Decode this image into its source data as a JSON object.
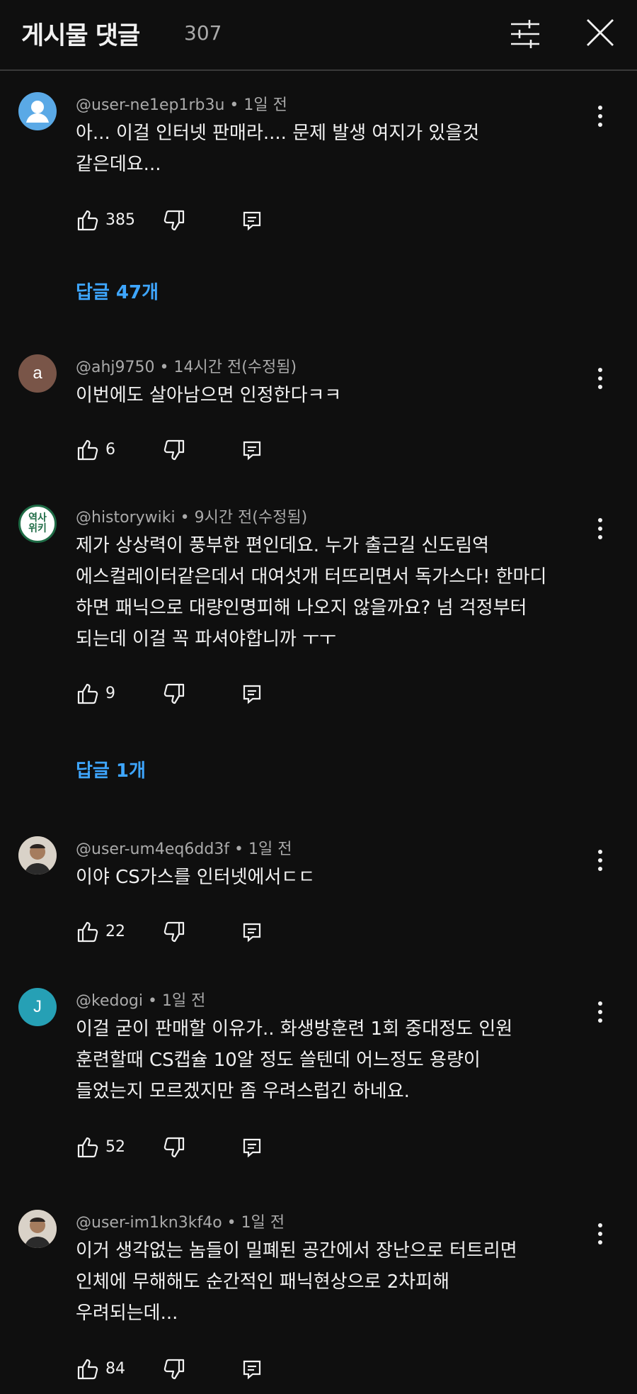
{
  "header": {
    "title": "게시물 댓글",
    "count": "307",
    "icons": [
      "filter-icon",
      "close-icon"
    ]
  },
  "comments": [
    {
      "author": "@user-ne1ep1rb3u",
      "time": "1일 전",
      "meta": "@user-ne1ep1rb3u • 1일 전",
      "avatar": {
        "type": "default-person",
        "color": "#5aa9e6"
      },
      "lines": [
        "아... 이걸 인터넷 판매라.... 문제 발생 여지가 있을것",
        "같은데요..."
      ],
      "likes": "385",
      "replies_label": "답글 47개"
    },
    {
      "author": "@ahj9750",
      "time": "14시간 전(수정됨)",
      "meta": "@ahj9750 • 14시간 전(수정됨)",
      "avatar": {
        "type": "letter",
        "letter": "a",
        "color": "#795548"
      },
      "lines": [
        "이번에도 살아남으면 인정한다ㅋㅋ"
      ],
      "likes": "6",
      "replies_label": ""
    },
    {
      "author": "@historywiki",
      "time": "9시간 전(수정됨)",
      "meta": "@historywiki • 9시간 전(수정됨)",
      "avatar": {
        "type": "logo",
        "text_top": "역사",
        "text_bottom": "위키",
        "color": "#1e6b45"
      },
      "lines": [
        "제가 상상력이 풍부한 편인데요. 누가 출근길 신도림역",
        "에스컬레이터같은데서 대여섯개 터뜨리면서 독가스다! 한마디",
        "하면 패닉으로 대량인명피해 나오지 않을까요? 넘 걱정부터",
        "되는데 이걸 꼭 파셔야합니까 ㅜㅜ"
      ],
      "likes": "9",
      "replies_label": "답글 1개"
    },
    {
      "author": "@user-um4eq6dd3f",
      "time": "1일 전",
      "meta": "@user-um4eq6dd3f • 1일 전",
      "avatar": {
        "type": "photo",
        "color": "#6b5a4e"
      },
      "lines": [
        "이야 CS가스를 인터넷에서ㄷㄷ"
      ],
      "likes": "22",
      "replies_label": ""
    },
    {
      "author": "@kedogi",
      "time": "1일 전",
      "meta": "@kedogi • 1일 전",
      "avatar": {
        "type": "letter",
        "letter": "J",
        "color": "#26a0b5"
      },
      "lines": [
        "이걸 굳이 판매할 이유가.. 화생방훈련 1회 중대정도 인원",
        "훈련할때 CS캡슐 10알 정도 쓸텐데 어느정도 용량이",
        "들었는지 모르겠지만 좀 우려스럽긴 하네요."
      ],
      "likes": "52",
      "replies_label": ""
    },
    {
      "author": "@user-im1kn3kf4o",
      "time": "1일 전",
      "meta": "@user-im1kn3kf4o • 1일 전",
      "avatar": {
        "type": "photo",
        "color": "#8a6a52"
      },
      "lines": [
        "이거 생각없는 놈들이 밀폐된 공간에서 장난으로 터트리면",
        "인체에 무해해도 순간적인 패닉현상으로 2차피해",
        "우려되는데..."
      ],
      "likes": "84",
      "replies_label": ""
    }
  ]
}
